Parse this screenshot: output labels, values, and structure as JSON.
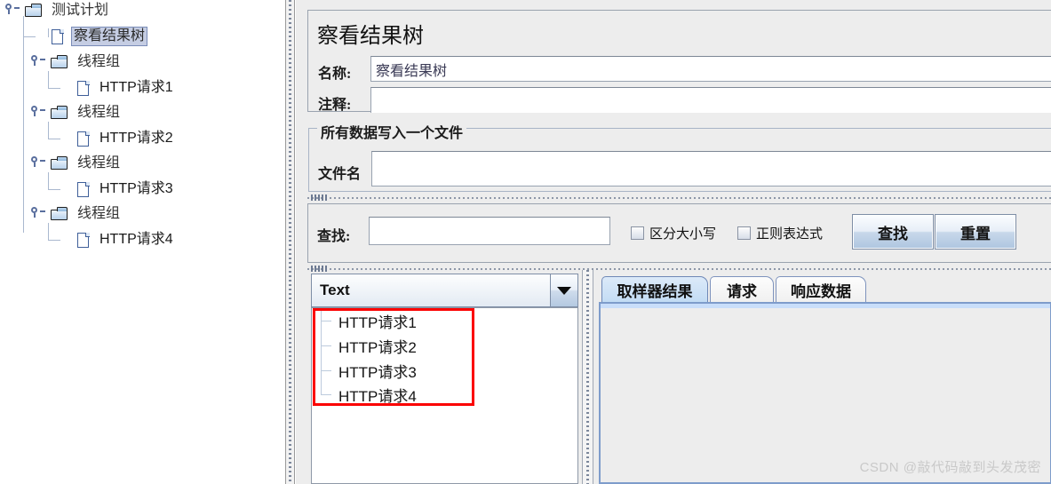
{
  "tree": {
    "nodes": [
      {
        "label": "测试计划",
        "icon": "folder-icon",
        "depth": 0,
        "selected": false
      },
      {
        "label": "察看结果树",
        "icon": "document-icon",
        "depth": 1,
        "selected": true
      },
      {
        "label": "线程组",
        "icon": "folder-icon",
        "depth": 1,
        "selected": false
      },
      {
        "label": "HTTP请求1",
        "icon": "document-icon",
        "depth": 2,
        "selected": false
      },
      {
        "label": "线程组",
        "icon": "folder-icon",
        "depth": 1,
        "selected": false
      },
      {
        "label": "HTTP请求2",
        "icon": "document-icon",
        "depth": 2,
        "selected": false
      },
      {
        "label": "线程组",
        "icon": "folder-icon",
        "depth": 1,
        "selected": false
      },
      {
        "label": "HTTP请求3",
        "icon": "document-icon",
        "depth": 2,
        "selected": false
      },
      {
        "label": "线程组",
        "icon": "folder-icon",
        "depth": 1,
        "selected": false
      },
      {
        "label": "HTTP请求4",
        "icon": "document-icon",
        "depth": 2,
        "selected": false
      }
    ]
  },
  "panel": {
    "title": "察看结果树",
    "name_label": "名称:",
    "name_value": "察看结果树",
    "comment_label": "注释:",
    "comment_value": "",
    "file_group_title": "所有数据写入一个文件",
    "filename_label": "文件名",
    "filename_value": ""
  },
  "search": {
    "label": "查找:",
    "value": "",
    "case_sensitive_label": "区分大小写",
    "case_sensitive_checked": false,
    "regex_label": "正则表达式",
    "regex_checked": false,
    "find_button": "查找",
    "reset_button": "重置"
  },
  "results": {
    "renderer_selected": "Text",
    "items": [
      "HTTP请求1",
      "HTTP请求2",
      "HTTP请求3",
      "HTTP请求4"
    ],
    "highlight_color": "#fb0000"
  },
  "tabs": {
    "items": [
      {
        "label": "取样器结果",
        "active": true
      },
      {
        "label": "请求",
        "active": false
      },
      {
        "label": "响应数据",
        "active": false
      }
    ]
  },
  "watermark": "CSDN @敲代码敲到头发茂密"
}
